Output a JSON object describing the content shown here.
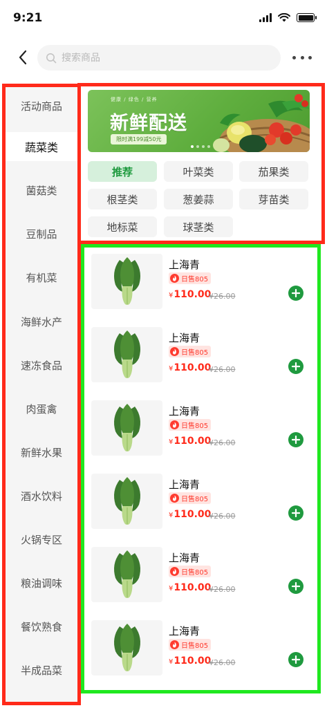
{
  "status": {
    "time": "9:21"
  },
  "header": {
    "search_placeholder": "搜索商品"
  },
  "sidebar": {
    "items": [
      {
        "label": "活动商品"
      },
      {
        "label": "蔬菜类"
      },
      {
        "label": "菌菇类"
      },
      {
        "label": "豆制品"
      },
      {
        "label": "有机菜"
      },
      {
        "label": "海鲜水产"
      },
      {
        "label": "速冻食品"
      },
      {
        "label": "肉蛋禽"
      },
      {
        "label": "新鲜水果"
      },
      {
        "label": "酒水饮料"
      },
      {
        "label": "火锅专区"
      },
      {
        "label": "粮油调味"
      },
      {
        "label": "餐饮熟食"
      },
      {
        "label": "半成品菜"
      }
    ],
    "active_index": 1
  },
  "banner": {
    "subtitle": "健康 / 绿色 / 营养",
    "title": "新鲜配送",
    "promo": "限时满199减50元"
  },
  "categories": [
    {
      "label": "推荐"
    },
    {
      "label": "叶菜类"
    },
    {
      "label": "茄果类"
    },
    {
      "label": "根茎类"
    },
    {
      "label": "葱姜蒜"
    },
    {
      "label": "芽苗类"
    },
    {
      "label": "地标菜"
    },
    {
      "label": "球茎类"
    }
  ],
  "products": [
    {
      "name": "上海青",
      "sales": "日售805",
      "currency": "¥",
      "price": "110.00",
      "old_price": "¥26.00"
    },
    {
      "name": "上海青",
      "sales": "日售805",
      "currency": "¥",
      "price": "110.00",
      "old_price": "¥26.00"
    },
    {
      "name": "上海青",
      "sales": "日售805",
      "currency": "¥",
      "price": "110.00",
      "old_price": "¥26.00"
    },
    {
      "name": "上海青",
      "sales": "日售805",
      "currency": "¥",
      "price": "110.00",
      "old_price": "¥26.00"
    },
    {
      "name": "上海青",
      "sales": "日售805",
      "currency": "¥",
      "price": "110.00",
      "old_price": "¥26.00"
    },
    {
      "name": "上海青",
      "sales": "日售805",
      "currency": "¥",
      "price": "110.00",
      "old_price": "¥26.00"
    }
  ],
  "colors": {
    "accent_green": "#1f9a3f",
    "price_red": "#ff2a1a",
    "annotation_red": "#ff2a1a",
    "annotation_green": "#1fe81f"
  }
}
